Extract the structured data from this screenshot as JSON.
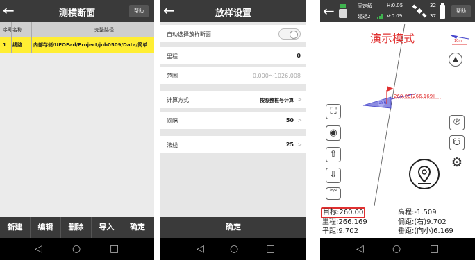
{
  "screen1": {
    "title": "测横断面",
    "help": "帮助",
    "columns": [
      "序号",
      "名称",
      "完整路径"
    ],
    "row": {
      "no": "1",
      "name": "线路",
      "path": "内部存储/UFOPad/Project/job0509/Data/简单"
    },
    "buttons": [
      "新建",
      "编辑",
      "删除",
      "导入",
      "确定"
    ]
  },
  "screen2": {
    "title": "放样设置",
    "rows": [
      {
        "label": "自动选择放样断面",
        "value": ""
      },
      {
        "label": "里程",
        "value": "0"
      },
      {
        "label": "范围",
        "value": "0.000～1026.008"
      },
      {
        "label": "计算方式",
        "value": "按照整桩号计算"
      },
      {
        "label": "间隔",
        "value": "50"
      },
      {
        "label": "法线",
        "value": "25"
      }
    ],
    "confirm": "确定"
  },
  "screen3": {
    "solution": "固定解",
    "delay": "延迟2",
    "h": "H:0.05",
    "v": "V:0.09",
    "sats_top": "32",
    "sats_bottom": "37",
    "help": "帮助",
    "mode": "演示模式",
    "scale": "10m",
    "station_label": "260.00[266.169]",
    "point_label": "186",
    "info": {
      "target": "目标:260.00",
      "elevation": "高程:-1.509",
      "mileage": "里程:266.169",
      "offset": "偏距:(右)9.702",
      "flat": "平距:9.702",
      "vertical": "垂距:(向小)6.169"
    }
  },
  "nav": {
    "back": "◁",
    "home": "○",
    "recent": "□"
  },
  "colors": {
    "header": "#3a3a3a",
    "highlight": "#ffee33",
    "accent": "#e03030",
    "map_line": "#4444cc"
  }
}
